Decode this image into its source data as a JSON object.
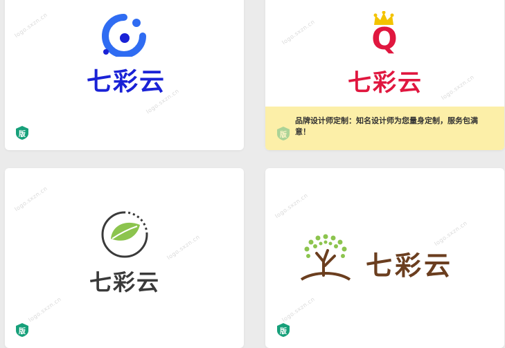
{
  "cards": [
    {
      "logo_text": "七彩云",
      "badge": "版",
      "watermark": "logo.sxzn.cn"
    },
    {
      "logo_text": "七彩云",
      "logo_letter": "Q",
      "badge": "版",
      "watermark": "logo.sxzn.cn",
      "promo": "品牌设计师定制：知名设计师为您量身定制，服务包满意！"
    },
    {
      "logo_text": "七彩云",
      "badge": "版",
      "watermark": "logo.sxzn.cn"
    },
    {
      "logo_text": "七彩云",
      "badge": "版",
      "watermark": "logo.sxzn.cn"
    }
  ],
  "colors": {
    "card1_logo": "#1a22d6",
    "card1_icon": "#2f6cf2",
    "card2_logo": "#e0173f",
    "card2_crown": "#f3c300",
    "card3_logo": "#3a3a3a",
    "card3_leaf": "#8cc44e",
    "card4_logo": "#6b3e1f",
    "card4_tree": "#8cc44e",
    "badge": "#17a07a",
    "promo_bg": "#fcefa8"
  }
}
